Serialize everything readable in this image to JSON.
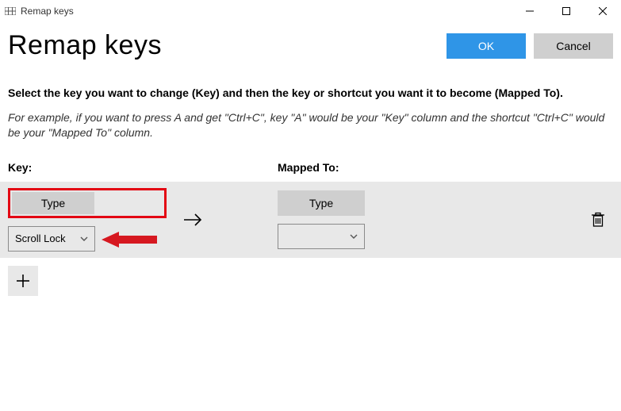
{
  "window": {
    "title": "Remap keys"
  },
  "header": {
    "page_title": "Remap keys",
    "ok_label": "OK",
    "cancel_label": "Cancel"
  },
  "body": {
    "instruction": "Select the key you want to change (Key) and then the key or shortcut you want it to become (Mapped To).",
    "example": "For example, if you want to press A and get \"Ctrl+C\", key \"A\" would be your \"Key\" column and the shortcut \"Ctrl+C\" would be your \"Mapped To\" column."
  },
  "columns": {
    "key_label": "Key:",
    "mapped_label": "Mapped To:"
  },
  "mapping": {
    "key_type_label": "Type",
    "key_selected": "Scroll Lock",
    "mapped_type_label": "Type",
    "mapped_selected": ""
  },
  "icons": {
    "chevron": "⌄"
  }
}
